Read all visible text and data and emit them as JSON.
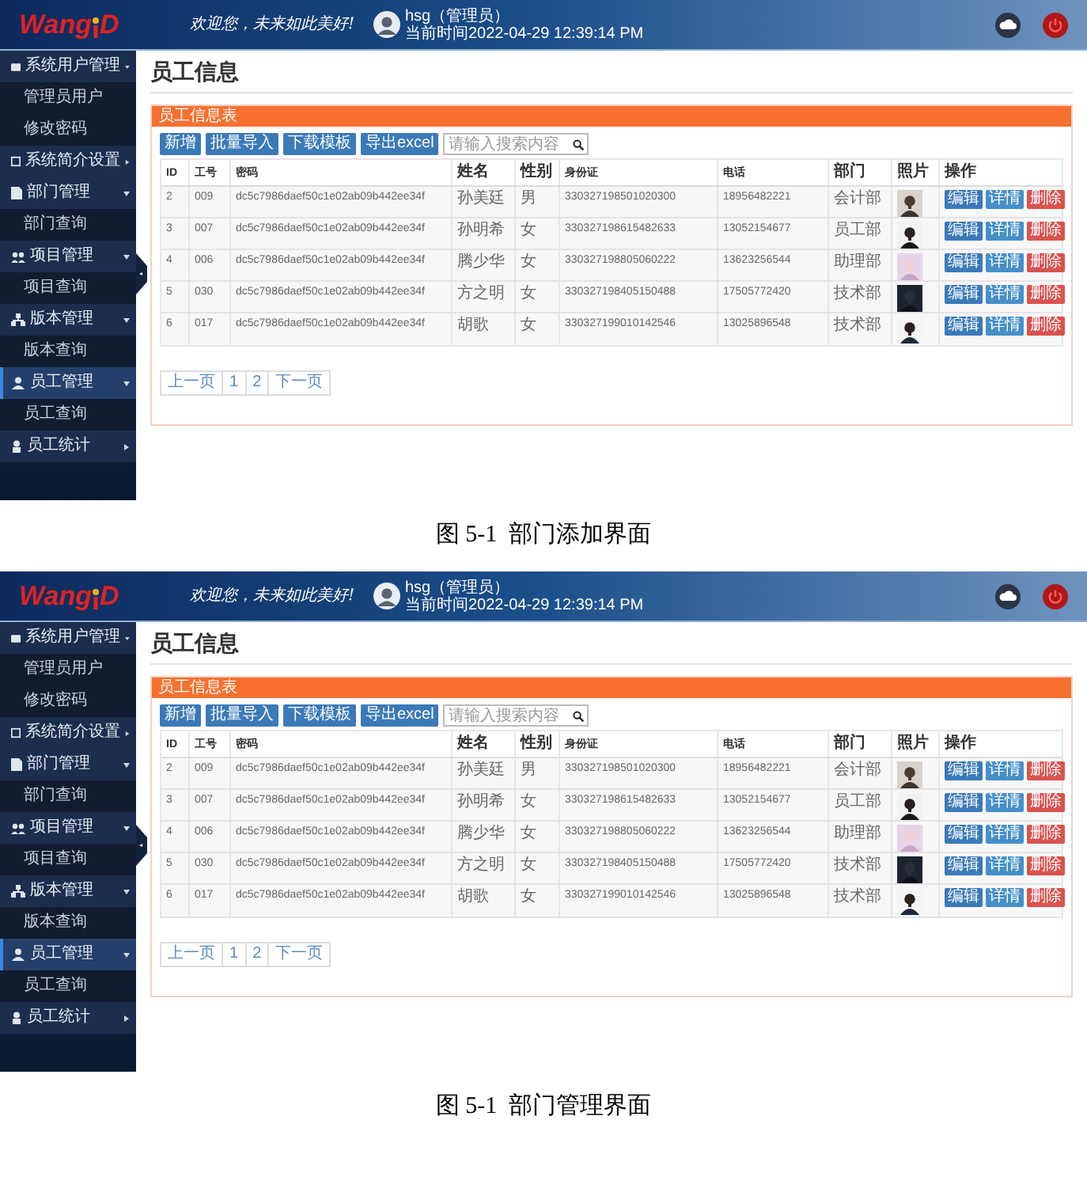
{
  "figures": [
    {
      "screen": {
        "logo": {
          "text": "Wang",
          "suffix": "D"
        },
        "slogan": "欢迎您，未来如此美好!",
        "user": {
          "name": "hsg（管理员）",
          "time": "当前时间2022-04-29 12:39:14 PM"
        },
        "sidebar": [
          {
            "label": "系统用户管理",
            "expanded": true,
            "selected": false,
            "children": [
              {
                "label": "管理员用户"
              },
              {
                "label": "修改密码"
              }
            ]
          },
          {
            "label": "系统简介设置",
            "expanded": false,
            "selected": false
          },
          {
            "label": "部门管理",
            "expanded": true,
            "selected": false,
            "children": [
              {
                "label": "部门查询"
              }
            ]
          },
          {
            "label": "项目管理",
            "expanded": true,
            "selected": false,
            "children": [
              {
                "label": "项目查询"
              }
            ]
          },
          {
            "label": "版本管理",
            "expanded": true,
            "selected": false,
            "children": [
              {
                "label": "版本查询"
              }
            ]
          },
          {
            "label": "员工管理",
            "expanded": true,
            "selected": true,
            "children": [
              {
                "label": "员工查询"
              }
            ]
          },
          {
            "label": "员工统计",
            "expanded": false,
            "selected": false
          }
        ],
        "page_title": "员工信息",
        "panel_title": "员工信息表",
        "toolbar": [
          "新增",
          "批量导入",
          "下载模板",
          "导出excel"
        ],
        "search": {
          "placeholder": "请输入搜索内容"
        },
        "table": {
          "columns": [
            "ID",
            "工号",
            "密码",
            "姓名",
            "性别",
            "身份证",
            "电话",
            "部门",
            "照片",
            "操作"
          ],
          "rows": [
            {
              "cells": [
                "2",
                "009",
                "dc5c7986daef50c1e02ab09b442ee34f",
                "孙美廷",
                "男",
                "330327198501020300",
                "18956482221",
                "会计部"
              ],
              "photo": {
                "kind": "picture"
              },
              "actions": [
                {
                  "label": "编辑",
                  "kind": "edit"
                },
                {
                  "label": "详情",
                  "kind": "detail"
                },
                {
                  "label": "删除",
                  "kind": "delete"
                }
              ]
            },
            {
              "cells": [
                "3",
                "007",
                "dc5c7986daef50c1e02ab09b442ee34f",
                "孙明希",
                "女",
                "330327198615482633",
                "13052154677",
                "员工部"
              ],
              "photo": {
                "kind": "picture"
              },
              "actions": [
                {
                  "label": "编辑",
                  "kind": "edit"
                },
                {
                  "label": "详情",
                  "kind": "detail"
                },
                {
                  "label": "删除",
                  "kind": "delete"
                }
              ]
            },
            {
              "cells": [
                "4",
                "006",
                "dc5c7986daef50c1e02ab09b442ee34f",
                "腾少华",
                "女",
                "330327198805060222",
                "13623256544",
                "助理部"
              ],
              "photo": {
                "kind": "picture"
              },
              "actions": [
                {
                  "label": "编辑",
                  "kind": "edit"
                },
                {
                  "label": "详情",
                  "kind": "detail"
                },
                {
                  "label": "删除",
                  "kind": "delete"
                }
              ]
            },
            {
              "cells": [
                "5",
                "030",
                "dc5c7986daef50c1e02ab09b442ee34f",
                "方之明",
                "女",
                "330327198405150488",
                "17505772420",
                "技术部"
              ],
              "photo": {
                "kind": "picture"
              },
              "actions": [
                {
                  "label": "编辑",
                  "kind": "edit"
                },
                {
                  "label": "详情",
                  "kind": "detail"
                },
                {
                  "label": "删除",
                  "kind": "delete"
                }
              ]
            },
            {
              "cells": [
                "6",
                "017",
                "dc5c7986daef50c1e02ab09b442ee34f",
                "胡歌",
                "女",
                "330327199010142546",
                "13025896548",
                "技术部"
              ],
              "photo": {
                "kind": "picture"
              },
              "actions": [
                {
                  "label": "编辑",
                  "kind": "edit"
                },
                {
                  "label": "详情",
                  "kind": "detail"
                },
                {
                  "label": "删除",
                  "kind": "delete"
                }
              ]
            }
          ]
        },
        "pagination": [
          "上一页",
          "1",
          "2",
          "下一页"
        ]
      },
      "caption": "图 5-1  部门添加界面"
    },
    {
      "screen": {
        "logo": {
          "text": "Wang",
          "suffix": "D"
        },
        "slogan": "欢迎您，未来如此美好!",
        "user": {
          "name": "hsg（管理员）",
          "time": "当前时间2022-04-29 12:39:14 PM"
        },
        "sidebar": [
          {
            "label": "系统用户管理",
            "expanded": true,
            "selected": false,
            "children": [
              {
                "label": "管理员用户"
              },
              {
                "label": "修改密码"
              }
            ]
          },
          {
            "label": "系统简介设置",
            "expanded": false,
            "selected": false
          },
          {
            "label": "部门管理",
            "expanded": true,
            "selected": false,
            "children": [
              {
                "label": "部门查询"
              }
            ]
          },
          {
            "label": "项目管理",
            "expanded": true,
            "selected": false,
            "children": [
              {
                "label": "项目查询"
              }
            ]
          },
          {
            "label": "版本管理",
            "expanded": true,
            "selected": false,
            "children": [
              {
                "label": "版本查询"
              }
            ]
          },
          {
            "label": "员工管理",
            "expanded": true,
            "selected": true,
            "children": [
              {
                "label": "员工查询"
              }
            ]
          },
          {
            "label": "员工统计",
            "expanded": false,
            "selected": false
          }
        ],
        "page_title": "员工信息",
        "panel_title": "员工信息表",
        "toolbar": [
          "新增",
          "批量导入",
          "下载模板",
          "导出excel"
        ],
        "search": {
          "placeholder": "请输入搜索内容"
        },
        "table": {
          "columns": [
            "ID",
            "工号",
            "密码",
            "姓名",
            "性别",
            "身份证",
            "电话",
            "部门",
            "照片",
            "操作"
          ],
          "rows": [
            {
              "cells": [
                "2",
                "009",
                "dc5c7986daef50c1e02ab09b442ee34f",
                "孙美廷",
                "男",
                "330327198501020300",
                "18956482221",
                "会计部"
              ],
              "photo": {
                "kind": "picture"
              },
              "actions": [
                {
                  "label": "编辑",
                  "kind": "edit"
                },
                {
                  "label": "详情",
                  "kind": "detail"
                },
                {
                  "label": "删除",
                  "kind": "delete"
                }
              ]
            },
            {
              "cells": [
                "3",
                "007",
                "dc5c7986daef50c1e02ab09b442ee34f",
                "孙明希",
                "女",
                "330327198615482633",
                "13052154677",
                "员工部"
              ],
              "photo": {
                "kind": "picture"
              },
              "actions": [
                {
                  "label": "编辑",
                  "kind": "edit"
                },
                {
                  "label": "详情",
                  "kind": "detail"
                },
                {
                  "label": "删除",
                  "kind": "delete"
                }
              ]
            },
            {
              "cells": [
                "4",
                "006",
                "dc5c7986daef50c1e02ab09b442ee34f",
                "腾少华",
                "女",
                "330327198805060222",
                "13623256544",
                "助理部"
              ],
              "photo": {
                "kind": "picture"
              },
              "actions": [
                {
                  "label": "编辑",
                  "kind": "edit"
                },
                {
                  "label": "详情",
                  "kind": "detail"
                },
                {
                  "label": "删除",
                  "kind": "delete"
                }
              ]
            },
            {
              "cells": [
                "5",
                "030",
                "dc5c7986daef50c1e02ab09b442ee34f",
                "方之明",
                "女",
                "330327198405150488",
                "17505772420",
                "技术部"
              ],
              "photo": {
                "kind": "picture"
              },
              "actions": [
                {
                  "label": "编辑",
                  "kind": "edit"
                },
                {
                  "label": "详情",
                  "kind": "detail"
                },
                {
                  "label": "删除",
                  "kind": "delete"
                }
              ]
            },
            {
              "cells": [
                "6",
                "017",
                "dc5c7986daef50c1e02ab09b442ee34f",
                "胡歌",
                "女",
                "330327199010142546",
                "13025896548",
                "技术部"
              ],
              "photo": {
                "kind": "picture"
              },
              "actions": [
                {
                  "label": "编辑",
                  "kind": "edit"
                },
                {
                  "label": "详情",
                  "kind": "detail"
                },
                {
                  "label": "删除",
                  "kind": "delete"
                }
              ]
            }
          ]
        },
        "pagination": [
          "上一页",
          "1",
          "2",
          "下一页"
        ]
      },
      "caption": "图 5-1  部门管理界面"
    }
  ]
}
